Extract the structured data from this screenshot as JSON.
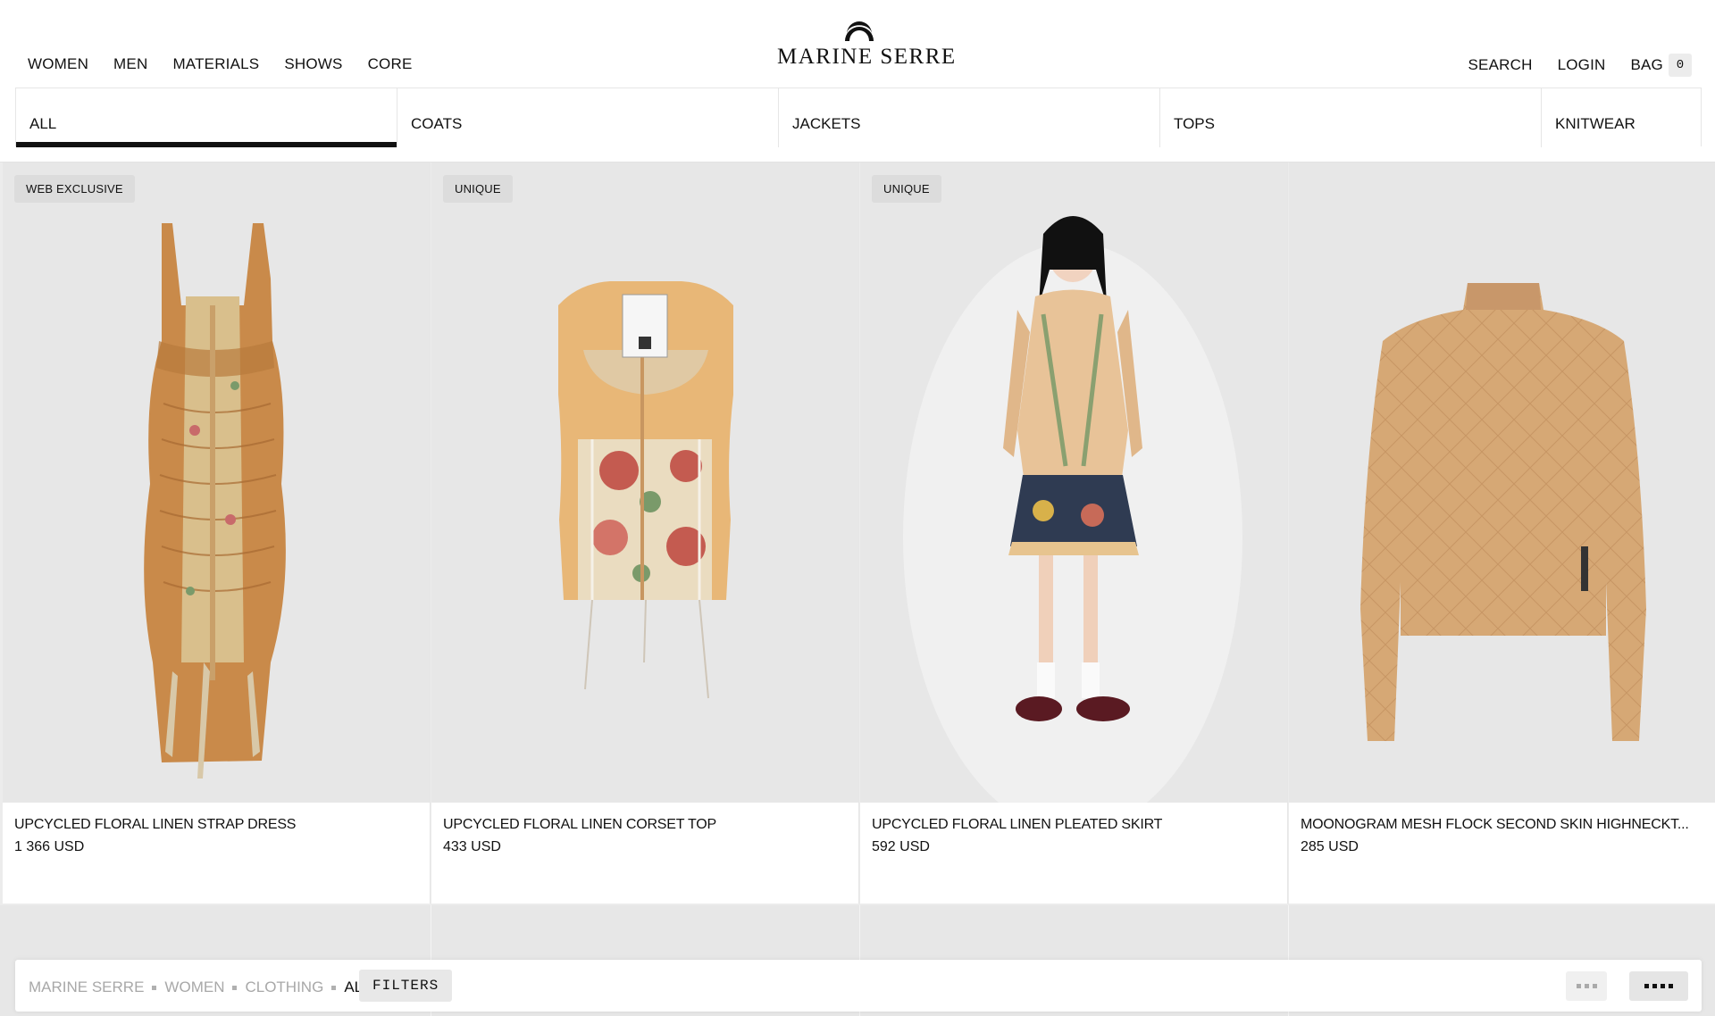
{
  "header": {
    "nav_left": [
      "WOMEN",
      "MEN",
      "MATERIALS",
      "SHOWS",
      "CORE"
    ],
    "logo_text": "MARINE SERRE",
    "search": "SEARCH",
    "login": "LOGIN",
    "bag": "BAG",
    "bag_count": "0"
  },
  "categories": [
    "ALL",
    "COATS",
    "JACKETS",
    "TOPS",
    "KNITWEAR"
  ],
  "active_category": "ALL",
  "products": [
    {
      "badge": "WEB EXCLUSIVE",
      "name": "UPCYCLED FLORAL LINEN STRAP DRESS",
      "price": "1 366 USD"
    },
    {
      "badge": "UNIQUE",
      "name": "UPCYCLED FLORAL LINEN CORSET TOP",
      "price": "433 USD"
    },
    {
      "badge": "UNIQUE",
      "name": "UPCYCLED FLORAL LINEN PLEATED SKIRT",
      "price": "592 USD"
    },
    {
      "badge": "",
      "name": "MOONOGRAM MESH FLOCK SECOND SKIN HIGHNECKT...",
      "price": "285 USD"
    }
  ],
  "breadcrumb": [
    "MARINE SERRE",
    "WOMEN",
    "CLOTHING",
    "ALL"
  ],
  "filters_label": "FILTERS",
  "colors": {
    "accent": "#111111",
    "tile_bg": "#e7e7e7",
    "badge_bg": "#dcdcdc",
    "crumb_muted": "#a8a8a8"
  },
  "icons": {
    "logo": "crescent-moon-icon",
    "grid_small": "grid-3-icon",
    "grid_large": "grid-4-icon"
  }
}
